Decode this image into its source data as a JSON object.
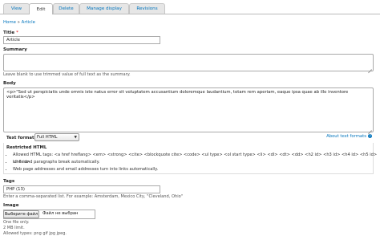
{
  "tabs": [
    {
      "label": "View",
      "active": false
    },
    {
      "label": "Edit",
      "active": true
    },
    {
      "label": "Delete",
      "active": false
    },
    {
      "label": "Manage display",
      "active": false
    },
    {
      "label": "Revisions",
      "active": false
    }
  ],
  "breadcrumb": {
    "home": "Home",
    "separator": "»",
    "current": "Article"
  },
  "title_field": {
    "label": "Title",
    "required_mark": "*",
    "value": "Article"
  },
  "summary_field": {
    "label": "Summary",
    "value": "",
    "description": "Leave blank to use trimmed value of full text as the summary."
  },
  "body_field": {
    "label": "Body",
    "value": "<p>\"Sed ut perspiciatis unde omnis iste natus error sit voluptatem accusantium doloremque laudantium, totam rem aperiam, eaque ipsa quae ab illo inventore veritatis</p>"
  },
  "text_format": {
    "label": "Text format",
    "selected": "Full HTML",
    "about_link": "About text formats",
    "heading": "Restricted HTML",
    "tips": [
      "Allowed HTML tags: <a href hreflang> <em> <strong> <cite> <blockquote cite> <code> <ul type> <ol start type> <li> <dl> <dt> <dd> <h2 id> <h3 id> <h4 id> <h5 id> <h6 id>",
      "Lines and paragraphs break automatically.",
      "Web page addresses and email addresses turn into links automatically."
    ]
  },
  "tags_field": {
    "label": "Tags",
    "value": "PHP (13)",
    "description": "Enter a comma-separated list. For example: Amsterdam, Mexico City, \"Cleveland, Ohio\""
  },
  "image_field": {
    "label": "Image",
    "button_label": "Выберите файл",
    "file_status": "Файл не выбран",
    "notes": [
      "One file only.",
      "2 MB limit.",
      "Allowed types: png gif jpg jpeg."
    ]
  },
  "colors": {
    "link": "#0074bd",
    "required": "#dd0000"
  }
}
